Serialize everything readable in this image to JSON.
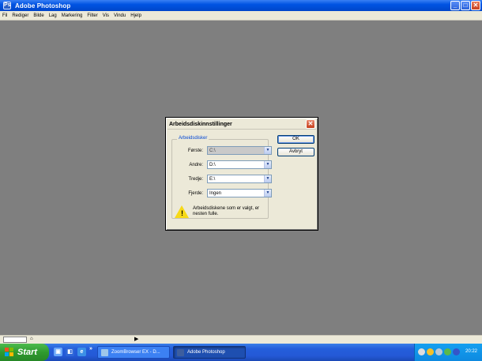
{
  "window": {
    "title": "Adobe Photoshop",
    "controls": {
      "minimize": "_",
      "maximize": "□",
      "close": "✕"
    }
  },
  "menu": [
    "Fil",
    "Rediger",
    "Bilde",
    "Lag",
    "Markering",
    "Filter",
    "Vis",
    "Vindu",
    "Hjelp"
  ],
  "dialog": {
    "title": "Arbeidsdiskinnstillinger",
    "close_label": "✕",
    "group_label": "Arbeidsdisker",
    "fields": [
      {
        "label": "Første:",
        "value": "C:\\",
        "disabled": true
      },
      {
        "label": "Andre:",
        "value": "D:\\",
        "disabled": false
      },
      {
        "label": "Tredje:",
        "value": "E:\\",
        "disabled": false
      },
      {
        "label": "Fjerde:",
        "value": "Ingen",
        "disabled": false
      }
    ],
    "warning": "Arbeidsdiskene som er valgt, er nesten fulle.",
    "ok_label": "OK",
    "cancel_label": "Avbryt"
  },
  "taskbar": {
    "start_label": "Start",
    "more_label": "»",
    "tasks": [
      {
        "label": "ZoomBrowser EX - D...",
        "active": false
      },
      {
        "label": "Adobe Photoshop",
        "active": true
      }
    ],
    "clock": "20:22"
  },
  "colors": {
    "workspace": "#7f7f7f",
    "titlebar": "#0054e3",
    "accent_blue": "#0046d5",
    "start_green": "#2f9a2f"
  }
}
